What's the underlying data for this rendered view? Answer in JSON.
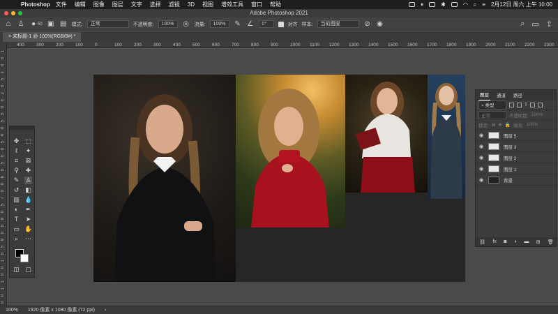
{
  "menubar": {
    "app_name": "Photoshop",
    "items": [
      "文件",
      "编辑",
      "图像",
      "图层",
      "文字",
      "选择",
      "滤镜",
      "3D",
      "视图",
      "增效工具",
      "窗口",
      "帮助"
    ],
    "datetime": "2月12日 周六 上午 10:00"
  },
  "window": {
    "title": "Adobe Photoshop 2021"
  },
  "options": {
    "brush_size": "50",
    "mode_label": "模式:",
    "mode_value": "正常",
    "opacity_label": "不透明度:",
    "opacity_value": "100%",
    "flow_label": "流量:",
    "flow_value": "100%",
    "angle_value": "0°",
    "align_label": "对齐",
    "sample_label": "样本:",
    "sample_value": "当前图层"
  },
  "document": {
    "tab_label": "未标题-1 @ 100%(RGB/8#) *",
    "zoom": "100%",
    "info": "1920 像素 x 1080 像素 (72 ppi)"
  },
  "ruler_h": [
    "400",
    "300",
    "200",
    "100",
    "0",
    "100",
    "200",
    "300",
    "400",
    "500",
    "600",
    "700",
    "800",
    "900",
    "1000",
    "1100",
    "1200",
    "1300",
    "1400",
    "1500",
    "1600",
    "1700",
    "1800",
    "1900",
    "2000",
    "2100",
    "2200",
    "2300"
  ],
  "ruler_v": [
    "1",
    "0",
    "0",
    "1",
    "5",
    "0",
    "2",
    "5",
    "0",
    "3",
    "5",
    "0",
    "4",
    "5",
    "0",
    "5",
    "5",
    "0",
    "6",
    "0",
    "0",
    "7",
    "5",
    "0",
    "8",
    "0",
    "0",
    "9",
    "5",
    "0",
    "1",
    "0",
    "0",
    "1",
    "1",
    "0",
    "0"
  ],
  "layers_panel": {
    "tabs": [
      "图层",
      "通道",
      "路径"
    ],
    "kind_label": "类型",
    "blend_mode": "正常",
    "opacity_label": "不透明度:",
    "opacity_value": "100%",
    "lock_label": "锁定:",
    "fill_label": "填充:",
    "fill_value": "100%",
    "layers": [
      "图层 5",
      "图层 3",
      "图层 2",
      "图层 1",
      "背景"
    ]
  },
  "colors": {
    "menubar_bg": "#1e1e1e",
    "ui_bg": "#535353",
    "panel_bg": "#3c3c3c",
    "traffic_red": "#ff5f57",
    "traffic_yellow": "#febc2e",
    "traffic_green": "#28c840"
  }
}
